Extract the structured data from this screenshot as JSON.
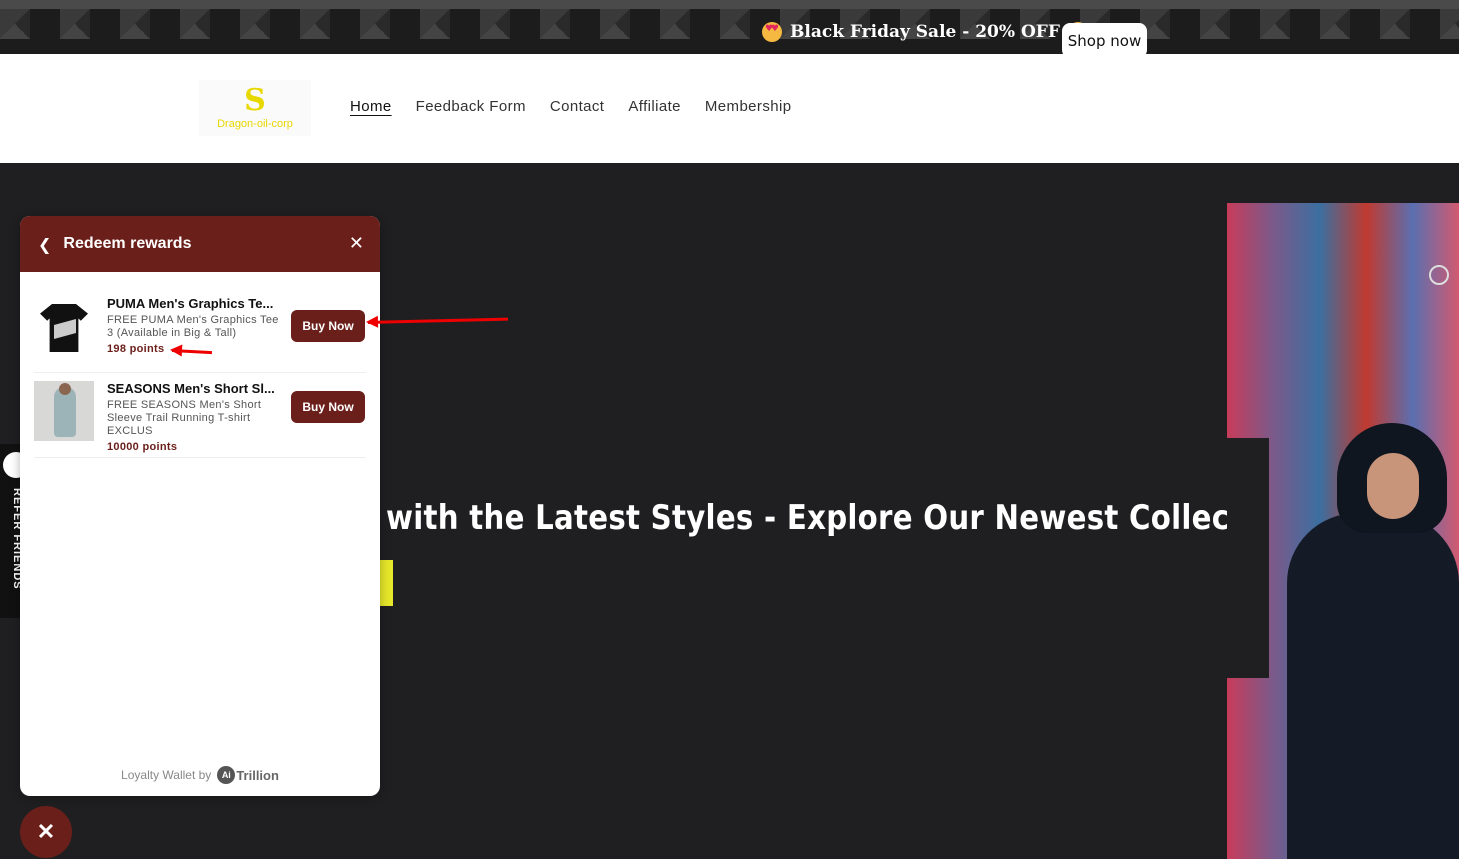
{
  "announcement": {
    "text": "Black Friday Sale - 20% OFF",
    "shop_label": "Shop now"
  },
  "header": {
    "logo_text": "Dragon-oil-corp",
    "logo_mark": "S",
    "nav": [
      "Home",
      "Feedback Form",
      "Contact",
      "Affiliate",
      "Membership"
    ],
    "active_nav": "Home"
  },
  "hero": {
    "title": "with the Latest Styles - Explore Our Newest Collection!"
  },
  "refer_tab": {
    "label": "REFER FRIENDS"
  },
  "panel": {
    "title": "Redeem rewards",
    "rewards": [
      {
        "name": "PUMA Men's Graphics Te...",
        "desc": "FREE PUMA Men's Graphics Tee 3 (Available in Big & Tall)",
        "points": "198 points",
        "button": "Buy Now"
      },
      {
        "name": "SEASONS Men's Short Sl...",
        "desc": "FREE SEASONS Men's Short Sleeve Trail Running T-shirt EXCLUS",
        "points": "10000 points",
        "button": "Buy Now"
      }
    ],
    "footer_text": "Loyalty Wallet by",
    "footer_logo": "Ai",
    "footer_brand": "Trillion"
  },
  "launcher": {
    "icon": "close-icon"
  },
  "colors": {
    "accent": "#6b1f1a",
    "hero_bg": "#1f1f21",
    "cta_yellow": "#e6e62a"
  }
}
